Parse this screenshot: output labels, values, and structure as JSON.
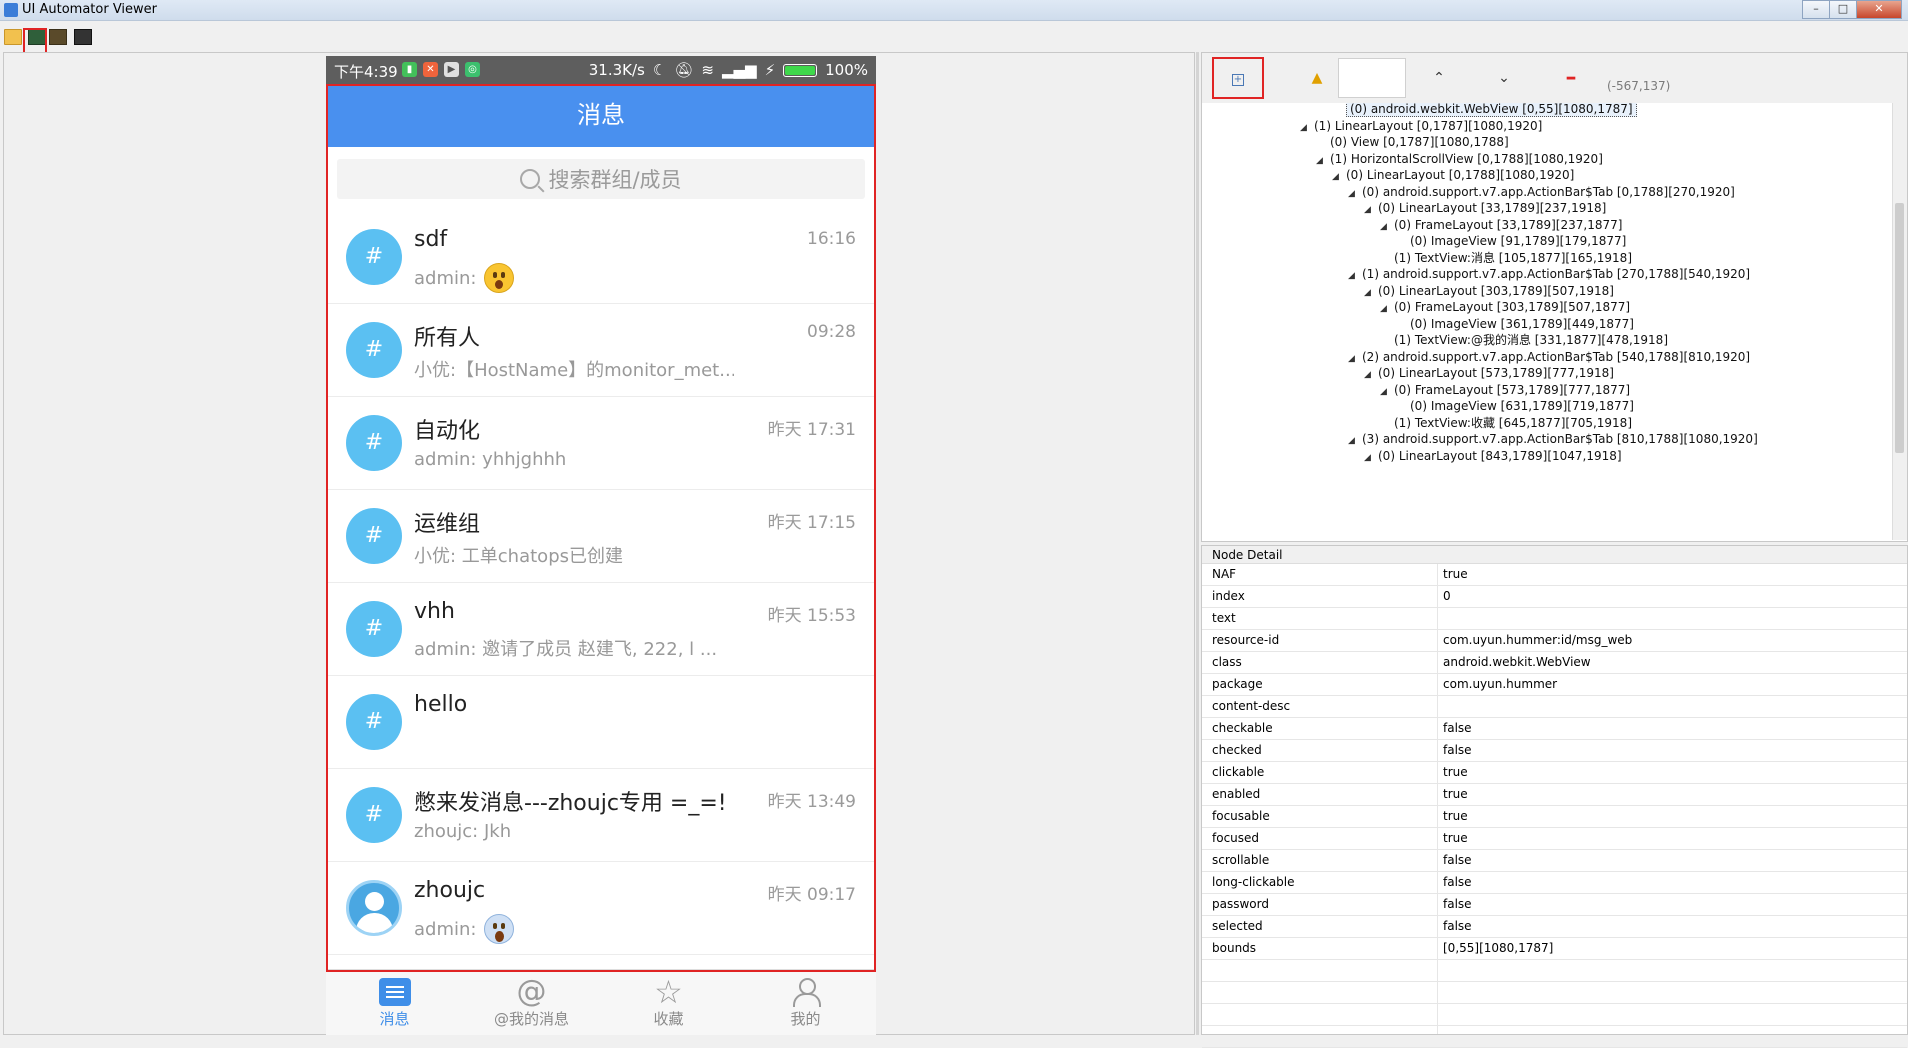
{
  "window": {
    "title": "UI Automator Viewer"
  },
  "phone": {
    "status": {
      "time": "下午4:39",
      "speed": "31.3K/s",
      "battery": "100%"
    },
    "header_title": "消息",
    "search_placeholder": "搜索群组/成员",
    "conversations": [
      {
        "name": "sdf",
        "msg": "admin:",
        "time": "16:16",
        "emoji": "surprised-emoji"
      },
      {
        "name": "所有人",
        "msg": "小优:【HostName】的monitor_met...",
        "time": "09:28"
      },
      {
        "name": "自动化",
        "msg": "admin: yhhjghhh",
        "time": "昨天 17:31"
      },
      {
        "name": "运维组",
        "msg": "小优: 工单chatops已创建",
        "time": "昨天 17:15"
      },
      {
        "name": "vhh",
        "msg": "admin: 邀请了成员 赵建飞, 222, l ...",
        "time": "昨天 15:53"
      },
      {
        "name": "hello",
        "msg": "",
        "time": ""
      },
      {
        "name": "憋来发消息---zhoujc专用 =_=!",
        "msg": "zhoujc: Jkh",
        "time": "昨天 13:49"
      },
      {
        "name": "zhoujc",
        "msg": "admin:",
        "time": "昨天 09:17",
        "emoji": "scream-emoji"
      }
    ],
    "tabs": [
      {
        "label": "消息",
        "icon": "message-icon",
        "active": true
      },
      {
        "label": "@我的消息",
        "icon": "at-icon",
        "active": false
      },
      {
        "label": "收藏",
        "icon": "star-icon",
        "active": false
      },
      {
        "label": "我的",
        "icon": "user-icon",
        "active": false
      }
    ],
    "avatar_glyph": "#",
    "accent": "#4990ef"
  },
  "hierarchy": {
    "coords": "(-567,137)",
    "rows": [
      {
        "text": "(0) android.webkit.WebView [0,55][1080,1787]",
        "level": 8,
        "tri": "",
        "selected": true
      },
      {
        "text": "(1) LinearLayout [0,1787][1080,1920]",
        "level": 6,
        "tri": "◢"
      },
      {
        "text": "(0) View [0,1787][1080,1788]",
        "level": 7,
        "tri": ""
      },
      {
        "text": "(1) HorizontalScrollView [0,1788][1080,1920]",
        "level": 7,
        "tri": "◢"
      },
      {
        "text": "(0) LinearLayout [0,1788][1080,1920]",
        "level": 8,
        "tri": "◢"
      },
      {
        "text": "(0) android.support.v7.app.ActionBar$Tab [0,1788][270,1920]",
        "level": 9,
        "tri": "◢"
      },
      {
        "text": "(0) LinearLayout [33,1789][237,1918]",
        "level": 10,
        "tri": "◢"
      },
      {
        "text": "(0) FrameLayout [33,1789][237,1877]",
        "level": 11,
        "tri": "◢"
      },
      {
        "text": "(0) ImageView [91,1789][179,1877]",
        "level": 12,
        "tri": ""
      },
      {
        "text": "(1) TextView:消息 [105,1877][165,1918]",
        "level": 11,
        "tri": ""
      },
      {
        "text": "(1) android.support.v7.app.ActionBar$Tab [270,1788][540,1920]",
        "level": 9,
        "tri": "◢"
      },
      {
        "text": "(0) LinearLayout [303,1789][507,1918]",
        "level": 10,
        "tri": "◢"
      },
      {
        "text": "(0) FrameLayout [303,1789][507,1877]",
        "level": 11,
        "tri": "◢"
      },
      {
        "text": "(0) ImageView [361,1789][449,1877]",
        "level": 12,
        "tri": ""
      },
      {
        "text": "(1) TextView:@我的消息 [331,1877][478,1918]",
        "level": 11,
        "tri": ""
      },
      {
        "text": "(2) android.support.v7.app.ActionBar$Tab [540,1788][810,1920]",
        "level": 9,
        "tri": "◢"
      },
      {
        "text": "(0) LinearLayout [573,1789][777,1918]",
        "level": 10,
        "tri": "◢"
      },
      {
        "text": "(0) FrameLayout [573,1789][777,1877]",
        "level": 11,
        "tri": "◢"
      },
      {
        "text": "(0) ImageView [631,1789][719,1877]",
        "level": 12,
        "tri": ""
      },
      {
        "text": "(1) TextView:收藏 [645,1877][705,1918]",
        "level": 11,
        "tri": ""
      },
      {
        "text": "(3) android.support.v7.app.ActionBar$Tab [810,1788][1080,1920]",
        "level": 9,
        "tri": "◢"
      },
      {
        "text": "(0) LinearLayout [843,1789][1047,1918]",
        "level": 10,
        "tri": "◢"
      }
    ]
  },
  "node_detail": {
    "title": "Node Detail",
    "rows": [
      {
        "k": "NAF",
        "v": "true"
      },
      {
        "k": "index",
        "v": "0"
      },
      {
        "k": "text",
        "v": ""
      },
      {
        "k": "resource-id",
        "v": "com.uyun.hummer:id/msg_web"
      },
      {
        "k": "class",
        "v": "android.webkit.WebView"
      },
      {
        "k": "package",
        "v": "com.uyun.hummer"
      },
      {
        "k": "content-desc",
        "v": ""
      },
      {
        "k": "checkable",
        "v": "false"
      },
      {
        "k": "checked",
        "v": "false"
      },
      {
        "k": "clickable",
        "v": "true"
      },
      {
        "k": "enabled",
        "v": "true"
      },
      {
        "k": "focusable",
        "v": "true"
      },
      {
        "k": "focused",
        "v": "true"
      },
      {
        "k": "scrollable",
        "v": "false"
      },
      {
        "k": "long-clickable",
        "v": "false"
      },
      {
        "k": "password",
        "v": "false"
      },
      {
        "k": "selected",
        "v": "false"
      },
      {
        "k": "bounds",
        "v": "[0,55][1080,1787]"
      }
    ]
  }
}
